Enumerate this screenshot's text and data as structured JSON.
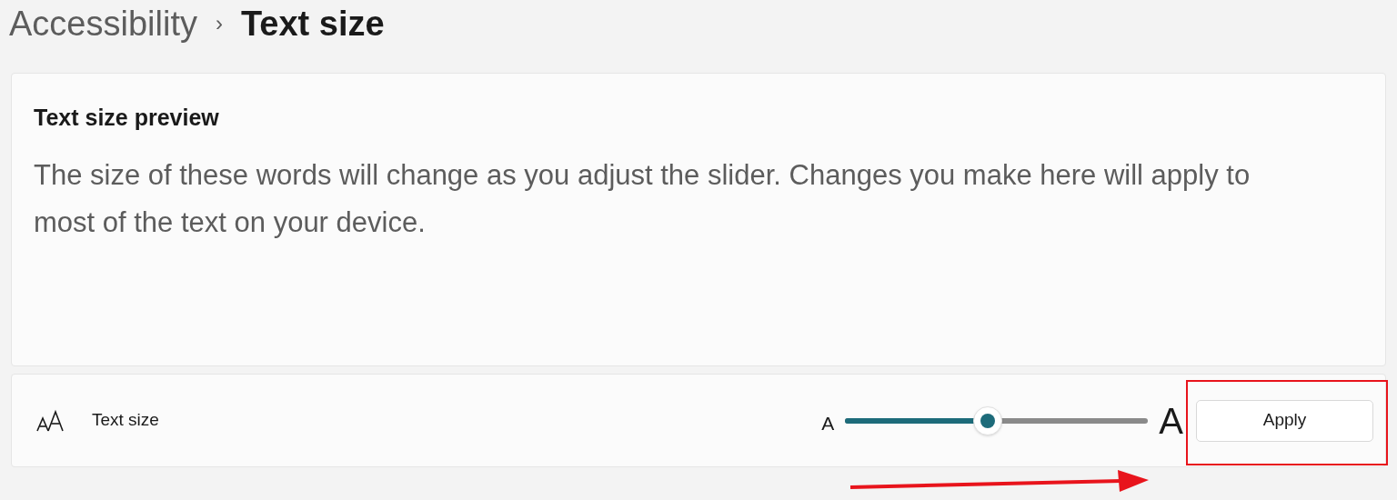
{
  "breadcrumb": {
    "parent": "Accessibility",
    "separator": "›",
    "current": "Text size"
  },
  "preview": {
    "title": "Text size preview",
    "text": "The size of these words will change as you adjust the slider. Changes you make here will apply to most of the text on your device."
  },
  "setting": {
    "label": "Text size",
    "slider": {
      "min_label": "A",
      "max_label": "A",
      "level": 0.47
    },
    "button": "Apply"
  }
}
